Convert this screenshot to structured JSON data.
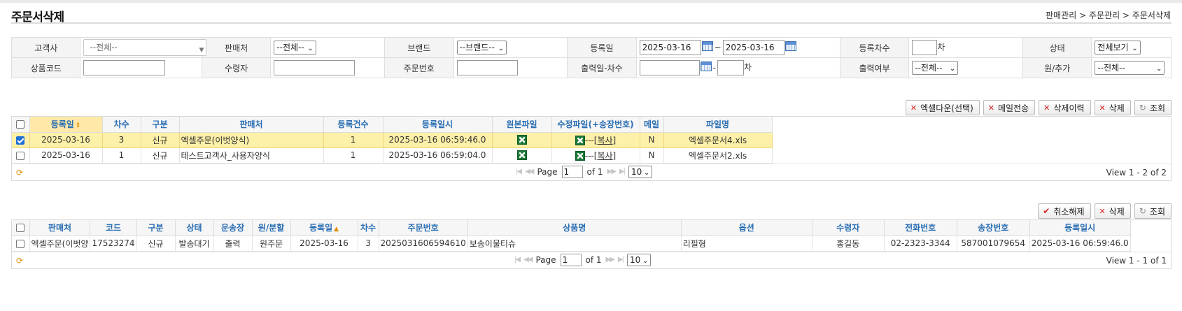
{
  "page": {
    "title": "주문서삭제",
    "breadcrumb": "판매관리 > 주문관리 > 주문서삭제"
  },
  "search": {
    "customer": {
      "label": "고객사",
      "value": "--전체--"
    },
    "seller": {
      "label": "판매처",
      "value": "--전체--"
    },
    "brand": {
      "label": "브랜드",
      "value": "--브랜드--"
    },
    "reg_date": {
      "label": "등록일",
      "from": "2025-03-16",
      "to": "2025-03-16",
      "sep": "~"
    },
    "reg_seq": {
      "label": "등록차수",
      "value": "",
      "suffix": "차"
    },
    "status": {
      "label": "상태",
      "value": "전체보기"
    },
    "product_code": {
      "label": "상품코드",
      "value": ""
    },
    "receiver": {
      "label": "수령자",
      "value": ""
    },
    "order_no": {
      "label": "주문번호",
      "value": ""
    },
    "print_date_seq": {
      "label": "출력일-차수",
      "date": "",
      "dash": "-",
      "seq": "",
      "suffix": "차"
    },
    "print_yn": {
      "label": "출력여부",
      "value": "--전체--"
    },
    "orig_add": {
      "label": "원/추가",
      "value": "--전체--"
    }
  },
  "toolbar1": {
    "excel_download": "엑셀다운(선택)",
    "mail_send": "메일전송",
    "delete_history": "삭제이력",
    "delete": "삭제",
    "search": "조회"
  },
  "grid1": {
    "headers": {
      "reg_date": "등록일",
      "seq": "차수",
      "type": "구분",
      "seller": "판매처",
      "count": "등록건수",
      "reg_datetime": "등록일시",
      "orig_file": "원본파일",
      "mod_file": "수정파일(+송장번호)",
      "mail": "메일",
      "filename": "파일명"
    },
    "rows": [
      {
        "reg_date": "2025-03-16",
        "seq": "3",
        "type": "신규",
        "seller": "엑셀주문(이벗양식)",
        "count": "1",
        "reg_datetime": "2025-03-16 06:59:46.0",
        "mod_dash": "---",
        "copy": "[복사]",
        "mail": "N",
        "filename": "엑셀주문서4.xls",
        "checked": true
      },
      {
        "reg_date": "2025-03-16",
        "seq": "1",
        "type": "신규",
        "seller": "테스트고객사_사용자양식",
        "count": "1",
        "reg_datetime": "2025-03-16 06:59:04.0",
        "mod_dash": "---",
        "copy": "[복사]",
        "mail": "N",
        "filename": "엑셀주문서2.xls",
        "checked": false
      }
    ],
    "pager": {
      "page_label": "Page",
      "page": "1",
      "of": "of 1",
      "size": "10",
      "view": "View 1 - 2 of 2"
    }
  },
  "toolbar2": {
    "cancel": "취소해제",
    "delete": "삭제",
    "search": "조회"
  },
  "grid2": {
    "headers": {
      "seller": "판매처",
      "code": "코드",
      "type": "구분",
      "status": "상태",
      "carrier": "운송장",
      "orig_split": "원/분할",
      "reg_date": "등록일",
      "seq": "차수",
      "order_no": "주문번호",
      "product": "상품명",
      "option": "옵션",
      "receiver": "수령자",
      "phone": "전화번호",
      "invoice": "송장번호",
      "reg_datetime": "등록일시"
    },
    "rows": [
      {
        "seller": "엑셀주문(이벗양",
        "code": "17523274",
        "type": "신규",
        "status": "발송대기",
        "carrier": "출력",
        "orig_split": "원주문",
        "reg_date": "2025-03-16",
        "seq": "3",
        "order_no": "2025031606594610",
        "product": "보송이물티슈",
        "option": "리필형",
        "receiver": "홍길동",
        "phone": "02-2323-3344",
        "invoice": "587001079654",
        "reg_datetime": "2025-03-16 06:59:46.0"
      }
    ],
    "pager": {
      "page_label": "Page",
      "page": "1",
      "of": "of 1",
      "size": "10",
      "view": "View 1 - 1 of 1"
    }
  }
}
